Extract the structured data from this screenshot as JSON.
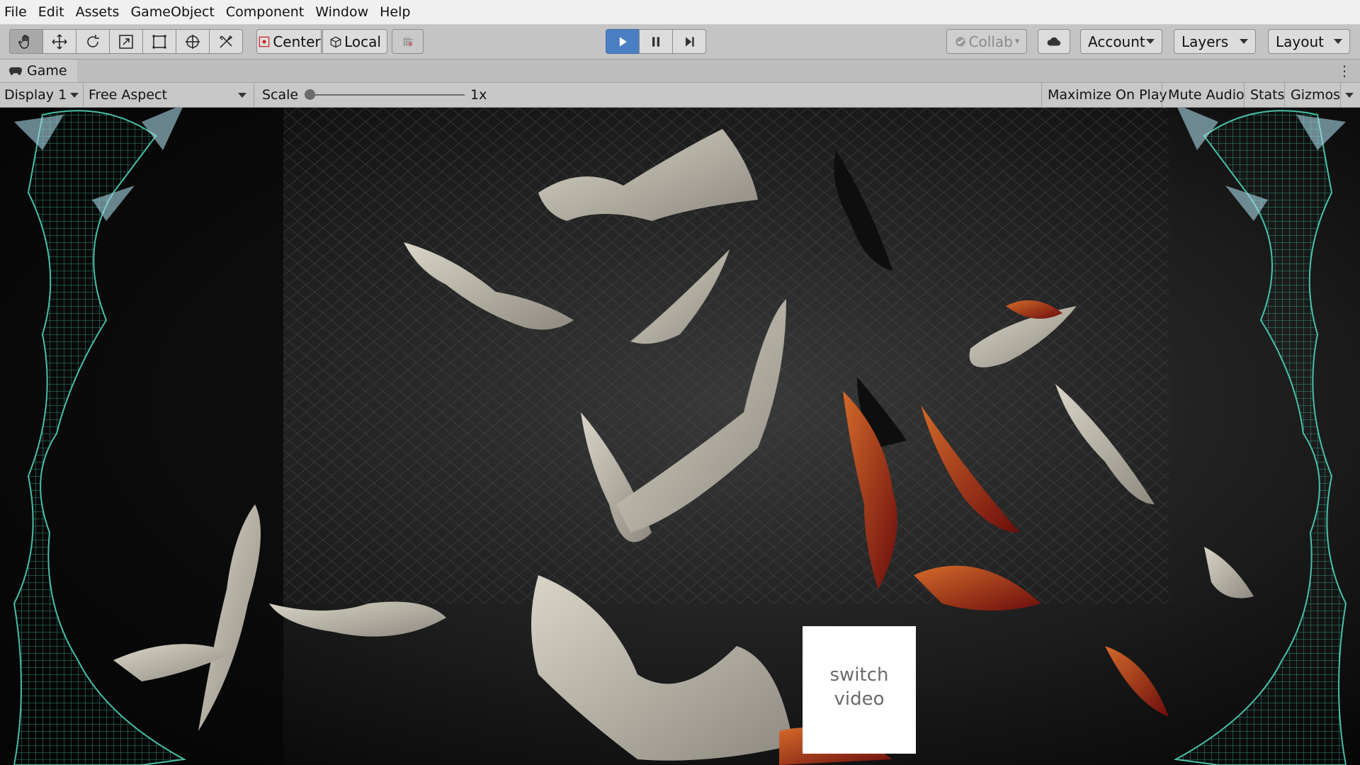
{
  "menu": [
    "File",
    "Edit",
    "Assets",
    "GameObject",
    "Component",
    "Window",
    "Help"
  ],
  "toolbar": {
    "tools": [
      "hand-icon",
      "move-icon",
      "rotate-icon",
      "scale-icon",
      "rect-tool-icon",
      "transform-icon",
      "custom-tool-icon"
    ],
    "pivot_label": "Center",
    "space_label": "Local",
    "collab_label": "Collab",
    "account_label": "Account",
    "layers_label": "Layers",
    "layout_label": "Layout",
    "play_state": "playing"
  },
  "panel": {
    "tab_label": "Game"
  },
  "gamebar": {
    "display_label": "Display 1",
    "aspect_label": "Free Aspect",
    "scale_label": "Scale",
    "scale_value": "1x",
    "maximize_label": "Maximize On Play",
    "mute_label": "Mute Audio",
    "stats_label": "Stats",
    "gizmos_label": "Gizmos"
  },
  "scene": {
    "button_text_line1": "switch",
    "button_text_line2": "video"
  },
  "colors": {
    "play_active": "#4b7fc4",
    "toolbar_bg": "#c4c4c4",
    "menubar_bg": "#f0f0f0",
    "wireframe": "#3fd4b0"
  }
}
